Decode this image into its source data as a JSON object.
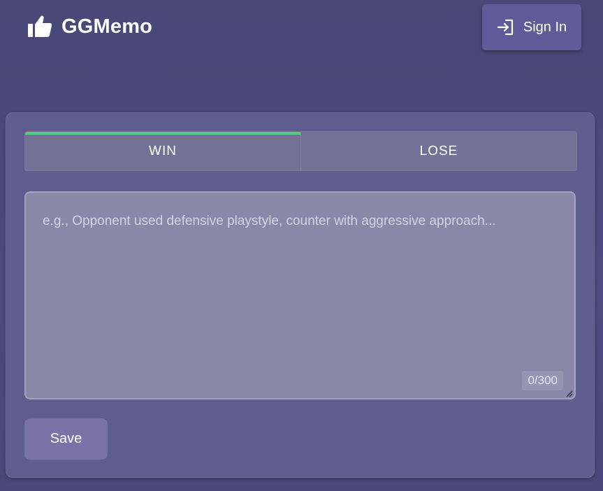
{
  "header": {
    "brand_name": "GGMemo",
    "brand_icon": "thumbs-up-icon",
    "signin_label": "Sign In",
    "signin_icon": "login-icon"
  },
  "tabs": [
    {
      "label": "WIN",
      "active": true
    },
    {
      "label": "LOSE",
      "active": false
    }
  ],
  "memo": {
    "value": "",
    "placeholder": "e.g., Opponent used defensive playstyle, counter with aggressive approach...",
    "counter": "0/300"
  },
  "actions": {
    "save_label": "Save"
  },
  "colors": {
    "background": "#4a4879",
    "card": "#5f5d8d",
    "active_tab_indicator": "#4ed07f",
    "save_button": "#7b72a8",
    "signin_button": "#5e5b98"
  }
}
